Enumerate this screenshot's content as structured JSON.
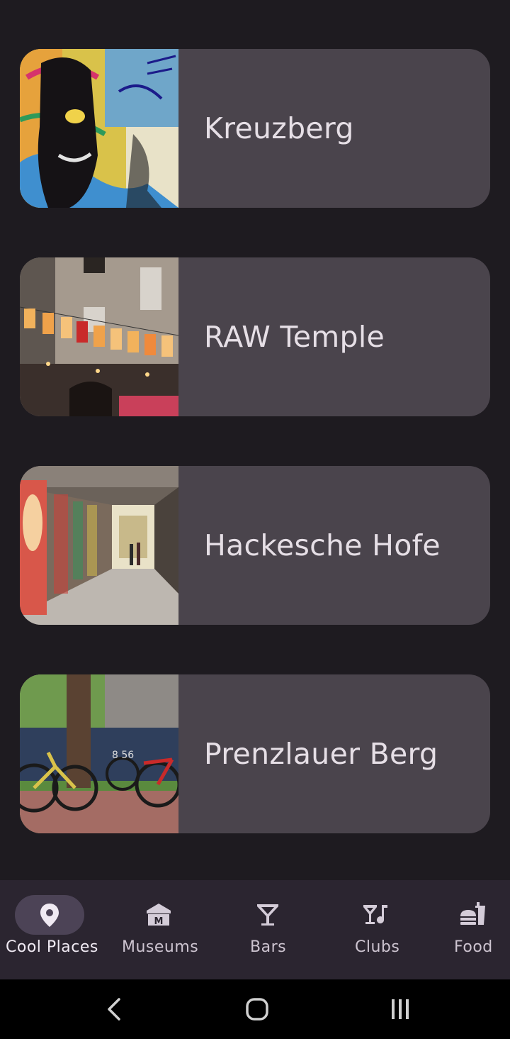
{
  "places": [
    {
      "name": "Kreuzberg",
      "image": "graffiti-wall-photo"
    },
    {
      "name": "RAW Temple",
      "image": "courtyard-bunting-photo"
    },
    {
      "name": "Hackesche Hofe",
      "image": "graffiti-passage-photo"
    },
    {
      "name": "Prenzlauer Berg",
      "image": "bicycles-tree-photo"
    }
  ],
  "bottom_nav": {
    "active": "Cool Places",
    "items": [
      {
        "label": "Cool Places",
        "icon": "location-pin-icon"
      },
      {
        "label": "Museums",
        "icon": "museum-icon"
      },
      {
        "label": "Bars",
        "icon": "cocktail-glass-icon"
      },
      {
        "label": "Clubs",
        "icon": "drink-music-icon"
      },
      {
        "label": "Food",
        "icon": "fastfood-icon"
      }
    ]
  },
  "system_nav": {
    "buttons": [
      "back-icon",
      "home-icon",
      "recents-icon"
    ]
  },
  "colors": {
    "background": "#1e1b20",
    "card": "#4a444c",
    "nav_bar": "#2b2530",
    "nav_active_pill": "#4c4356",
    "text": "#e6dfe6"
  }
}
